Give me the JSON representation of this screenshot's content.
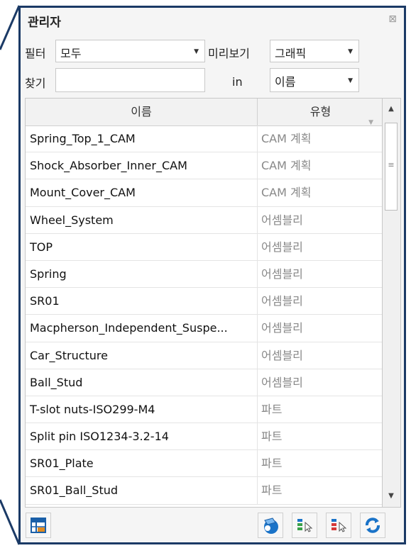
{
  "panel": {
    "title": "관리자",
    "close_icon": "close-icon"
  },
  "filter": {
    "label": "필터",
    "value": "모두"
  },
  "preview": {
    "label": "미리보기",
    "value": "그래픽"
  },
  "search": {
    "label": "찾기",
    "value": "",
    "in_label": "in",
    "field_value": "이름"
  },
  "table": {
    "columns": [
      "이름",
      "유형"
    ],
    "rows": [
      {
        "name": "Spring_Top_1_CAM",
        "type": "CAM 계획"
      },
      {
        "name": "Shock_Absorber_Inner_CAM",
        "type": "CAM 계획"
      },
      {
        "name": "Mount_Cover_CAM",
        "type": "CAM 계획"
      },
      {
        "name": "Wheel_System",
        "type": "어셈블리"
      },
      {
        "name": "TOP",
        "type": "어셈블리"
      },
      {
        "name": "Spring",
        "type": "어셈블리"
      },
      {
        "name": "SR01",
        "type": "어셈블리"
      },
      {
        "name": "Macpherson_Independent_Suspe...",
        "type": "어셈블리"
      },
      {
        "name": "Car_Structure",
        "type": "어셈블리"
      },
      {
        "name": "Ball_Stud",
        "type": "어셈블리"
      },
      {
        "name": "T-slot nuts-ISO299-M4",
        "type": "파트"
      },
      {
        "name": "Split pin ISO1234-3.2-14",
        "type": "파트"
      },
      {
        "name": "SR01_Plate",
        "type": "파트"
      },
      {
        "name": "SR01_Ball_Stud",
        "type": "파트"
      }
    ]
  },
  "toolbar": {
    "icons": [
      "grid-view-icon",
      "3d-view-icon",
      "select-green-icon",
      "select-red-icon",
      "refresh-icon"
    ]
  },
  "colors": {
    "frame_border": "#1b3a66",
    "accent_blue": "#1a73c8"
  }
}
